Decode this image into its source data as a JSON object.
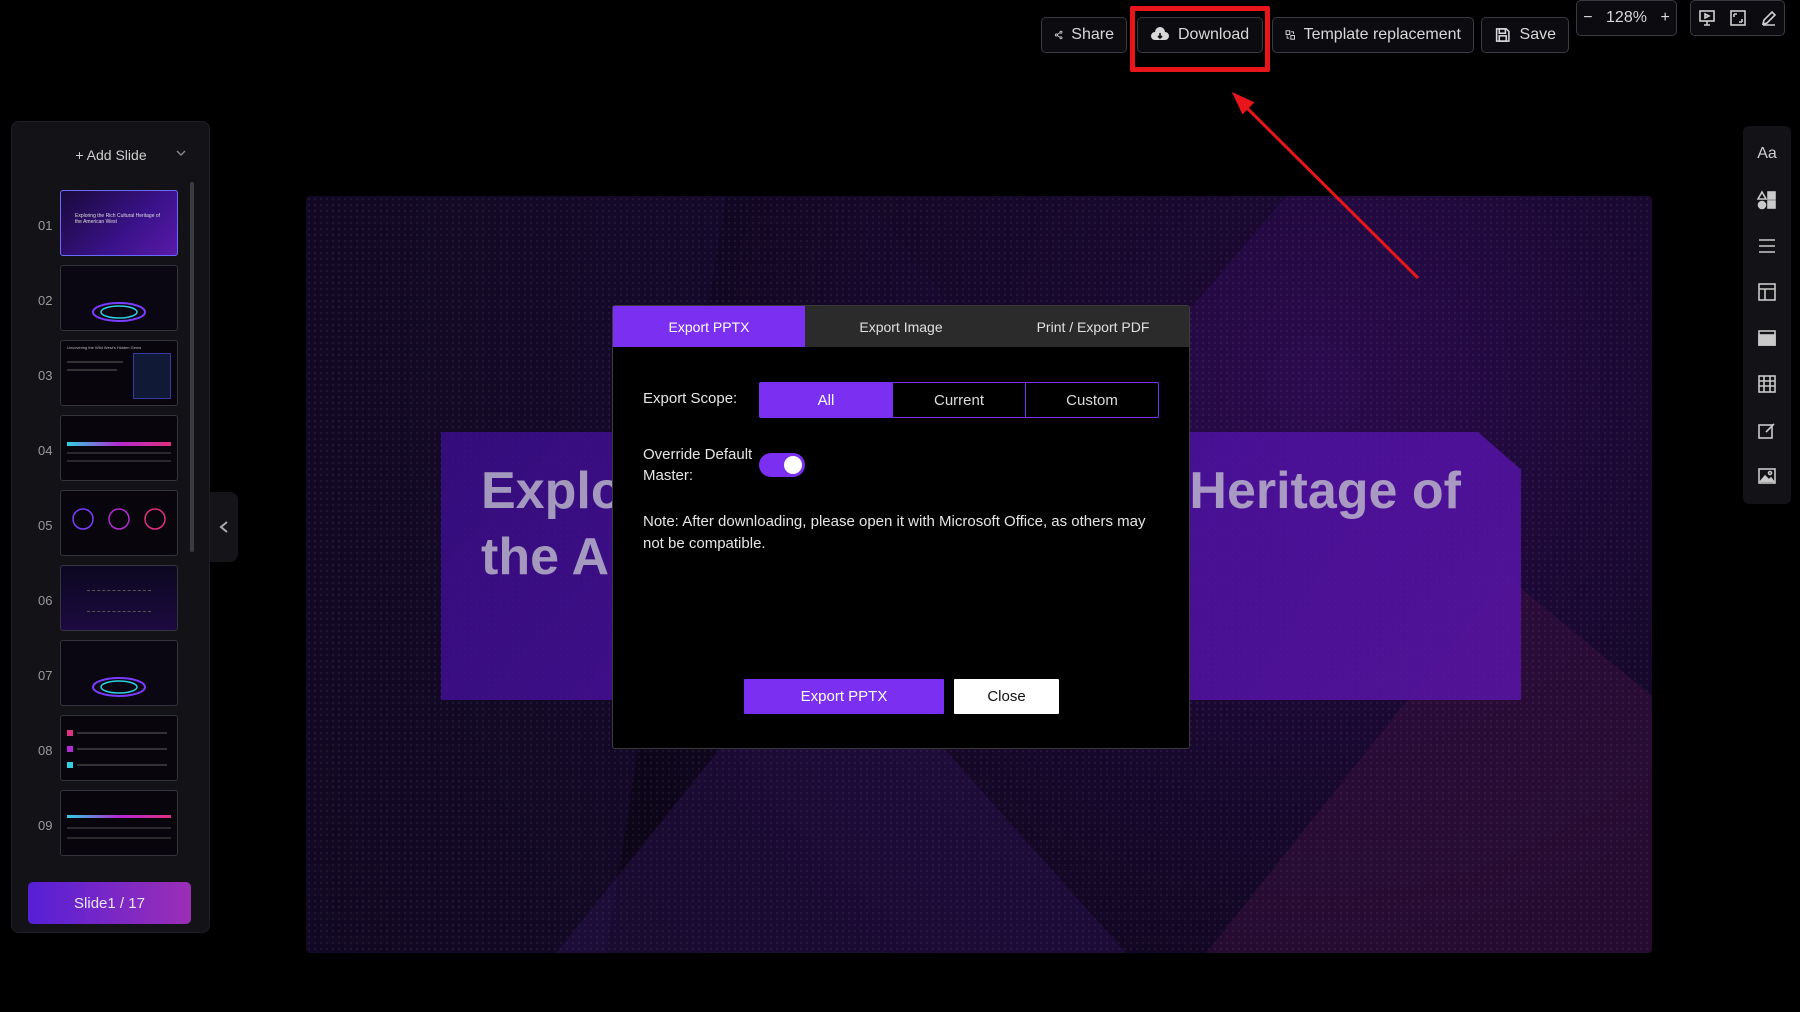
{
  "toolbar": {
    "share_label": "Share",
    "download_label": "Download",
    "template_label": "Template replacement",
    "save_label": "Save",
    "zoom_minus": "−",
    "zoom_level": "128%",
    "zoom_plus": "+"
  },
  "sidebar": {
    "add_slide_label": "+ Add Slide",
    "slides": [
      {
        "num": "01",
        "title": "Exploring the Rich Cultural Heritage of the American West"
      },
      {
        "num": "02",
        "title": ""
      },
      {
        "num": "03",
        "title": "Uncovering the Wild West's Hidden Gems"
      },
      {
        "num": "04",
        "title": ""
      },
      {
        "num": "05",
        "title": ""
      },
      {
        "num": "06",
        "title": ""
      },
      {
        "num": "07",
        "title": ""
      },
      {
        "num": "08",
        "title": ""
      },
      {
        "num": "09",
        "title": ""
      }
    ],
    "slide_counter": "Slide1 / 17"
  },
  "slide": {
    "title_left": "Explo",
    "title_right": "Heritage of",
    "title_line2": "the A"
  },
  "dialog": {
    "tabs": [
      "Export PPTX",
      "Export Image",
      "Print / Export PDF"
    ],
    "active_tab": "Export PPTX",
    "scope_label": "Export Scope:",
    "scope_options": [
      "All",
      "Current",
      "Custom"
    ],
    "scope_selected": "All",
    "override_label": "Override Default Master:",
    "override_on": true,
    "note": "Note: After downloading, please open it with Microsoft Office, as others may not be compatible.",
    "export_button": "Export PPTX",
    "close_button": "Close"
  },
  "right_bar": {
    "items": [
      "text-style-icon",
      "shapes-icon",
      "align-icon",
      "layout-icon",
      "background-icon",
      "table-icon",
      "edit-icon",
      "image-icon"
    ],
    "text_style_label": "Aa"
  },
  "colors": {
    "accent": "#7b2ff0",
    "highlight": "#e8161b",
    "background": "#000000"
  }
}
